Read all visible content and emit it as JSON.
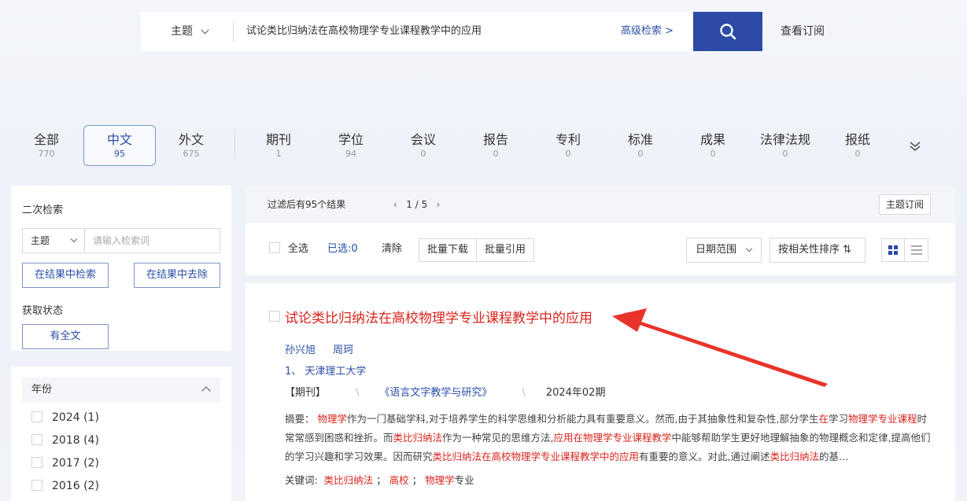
{
  "search": {
    "field": "主题",
    "query": "试论类比归纳法在高校物理学专业课程教学中的应用",
    "advanced": "高级检索 >",
    "subscribe": "查看订阅"
  },
  "categories": [
    {
      "label": "全部",
      "count": "770"
    },
    {
      "label": "中文",
      "count": "95"
    },
    {
      "label": "外文",
      "count": "675"
    },
    {
      "label": "期刊",
      "count": "1"
    },
    {
      "label": "学位",
      "count": "94"
    },
    {
      "label": "会议",
      "count": "0"
    },
    {
      "label": "报告",
      "count": "0"
    },
    {
      "label": "专利",
      "count": "0"
    },
    {
      "label": "标准",
      "count": "0"
    },
    {
      "label": "成果",
      "count": "0"
    },
    {
      "label": "法律法规",
      "count": "0"
    },
    {
      "label": "报纸",
      "count": "0"
    }
  ],
  "left": {
    "title": "二次检索",
    "field": "主题",
    "placeholder": "请输入检索词",
    "btn_in": "在结果中检索",
    "btn_out": "在结果中去除",
    "status_title": "获取状态",
    "status_btn": "有全文",
    "year_title": "年份",
    "years": [
      {
        "label": "2024",
        "count": "(1)"
      },
      {
        "label": "2018",
        "count": "(4)"
      },
      {
        "label": "2017",
        "count": "(2)"
      },
      {
        "label": "2016",
        "count": "(2)"
      }
    ]
  },
  "results": {
    "count_text": "过滤后有95个结果",
    "page": "1 / 5",
    "topic_sub": "主题订阅",
    "select_all": "全选",
    "selected": "已选:0",
    "clear": "清除",
    "batch_download": "批量下载",
    "batch_cite": "批量引用",
    "date_range": "日期范围",
    "sort": "按相关性排序 ⇅"
  },
  "item": {
    "title": "试论类比归纳法在高校物理学专业课程教学中的应用",
    "authors": [
      "孙兴旭",
      "周珂"
    ],
    "org": "1、 天津理工大学",
    "type": "【期刊】",
    "journal": "《语言文字教学与研究》",
    "date": "2024年02期",
    "abstract_label": "摘要：",
    "keywords_label": "关键词:",
    "keywords": [
      "类比归纳法",
      "高校",
      "物理学"
    ],
    "keyword_suffix": "专业"
  },
  "colors": {
    "accent": "#2b4ba6",
    "highlight": "#d9241c"
  }
}
